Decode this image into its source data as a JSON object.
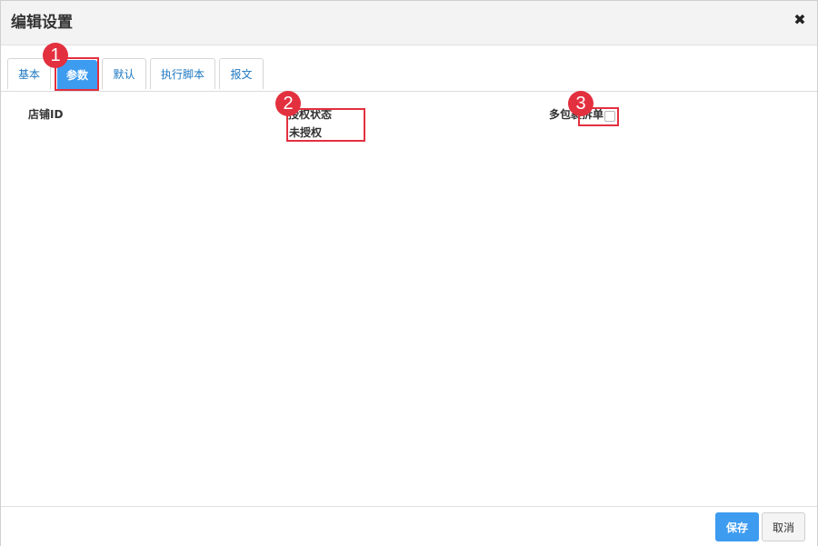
{
  "dialog": {
    "title": "编辑设置",
    "close_glyph": "✖"
  },
  "tabs": [
    {
      "label": "基本",
      "active": false
    },
    {
      "label": "参数",
      "active": true
    },
    {
      "label": "默认",
      "active": false
    },
    {
      "label": "执行脚本",
      "active": false
    },
    {
      "label": "报文",
      "active": false
    }
  ],
  "fields": {
    "shop_id": {
      "label": "店铺ID"
    },
    "auth_status": {
      "label": "授权状态",
      "value": "未授权"
    },
    "multi_package": {
      "label": "多包裹拆单",
      "checked": false
    }
  },
  "annotations": [
    "1",
    "2",
    "3"
  ],
  "footer": {
    "save_label": "保存",
    "cancel_label": "取消"
  },
  "colors": {
    "accent": "#3d9bf0",
    "annotation": "#e3303f",
    "tab_text": "#1d78c2"
  }
}
